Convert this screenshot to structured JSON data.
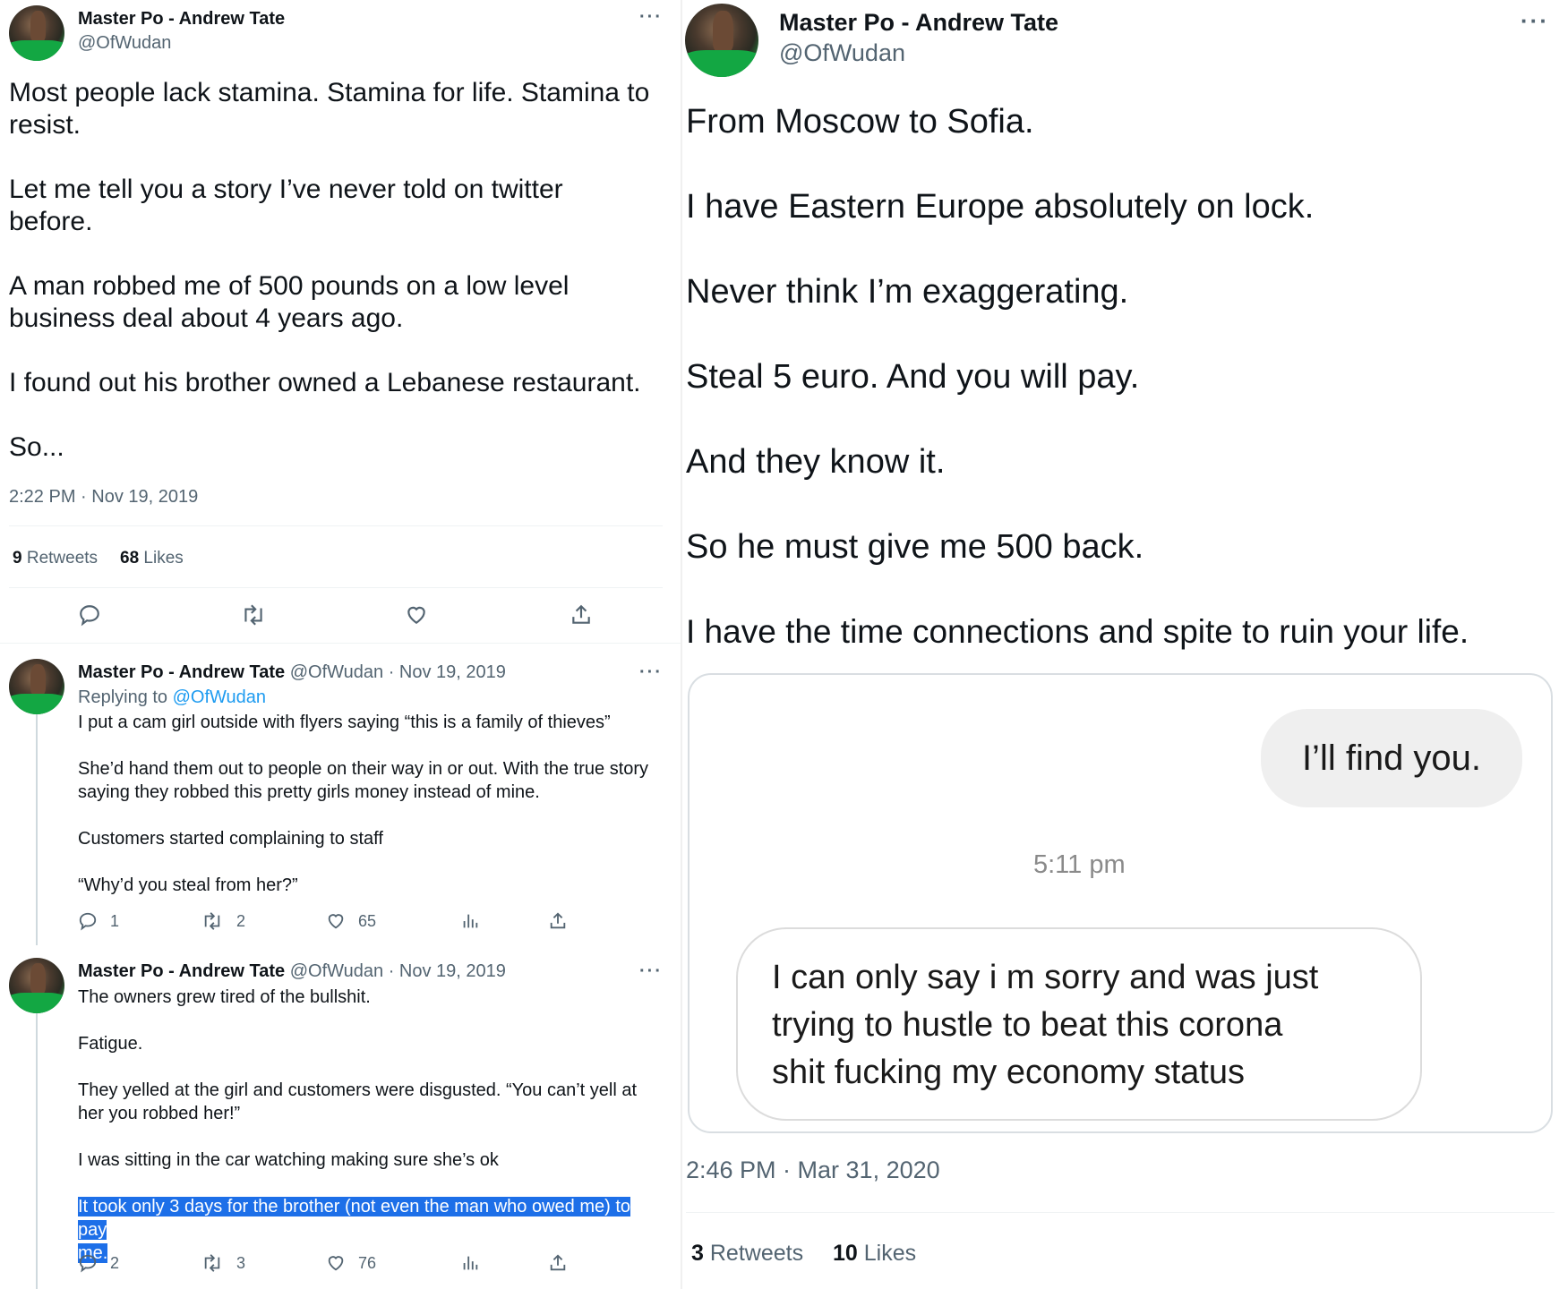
{
  "left": {
    "main_tweet": {
      "name": "Master Po - Andrew Tate",
      "handle": "@OfWudan",
      "paragraphs": [
        "Most people lack stamina. Stamina for life. Stamina to resist.",
        "Let me tell you a story I’ve never told on twitter before.",
        "A man robbed me of 500 pounds on a low level business deal about 4 years ago.",
        "I found out his brother owned a Lebanese restaurant.",
        "So..."
      ],
      "timestamp": "2:22 PM · Nov 19, 2019",
      "retweets_count": "9",
      "retweets_label": "Retweets",
      "likes_count": "68",
      "likes_label": "Likes",
      "more": "···"
    },
    "reply1": {
      "name": "Master Po - Andrew Tate",
      "meta": "@OfWudan · Nov 19, 2019",
      "replying_prefix": "Replying to",
      "replying_handle": "@OfWudan",
      "paragraphs": [
        "I put a cam girl outside with flyers saying “this is a family of thieves”",
        "She’d hand them out to people on their way in or out. With the true story saying they robbed this pretty girls money instead of mine.",
        "Customers started complaining to staff",
        "“Why’d you steal from her?”"
      ],
      "replies": "1",
      "retweets": "2",
      "likes": "65",
      "more": "···"
    },
    "reply2": {
      "name": "Master Po - Andrew Tate",
      "meta": "@OfWudan · Nov 19, 2019",
      "paragraphs": [
        "The owners grew tired of the bullshit.",
        "Fatigue.",
        "They yelled at the girl and customers were disgusted. “You can’t yell at her you robbed her!”",
        "I was sitting in the car watching making sure she’s ok"
      ],
      "highlighted_line1": "It took only 3 days for the brother (not even the man who owed me) to pay",
      "highlighted_line2": "me.",
      "replies": "2",
      "retweets": "3",
      "likes": "76",
      "more": "···"
    }
  },
  "right": {
    "name": "Master Po - Andrew Tate",
    "handle": "@OfWudan",
    "more": "···",
    "paragraphs": [
      "From Moscow to Sofia.",
      "I have Eastern Europe absolutely on lock.",
      "Never think I’m exaggerating.",
      "Steal 5 euro. And you will pay.",
      "And they know it.",
      "So he must give me 500 back.",
      "I have the time connections and spite to ruin your life."
    ],
    "image": {
      "sent_message": "I’ll find you.",
      "time": "5:11 pm",
      "received_line1": "I can only say i m sorry and  was just",
      "received_line2": "trying to hustle to beat this corona",
      "received_line3": "shit fucking my economy status"
    },
    "timestamp": "2:46 PM · Mar 31, 2020",
    "retweets_count": "3",
    "retweets_label": "Retweets",
    "likes_count": "10",
    "likes_label": "Likes"
  }
}
